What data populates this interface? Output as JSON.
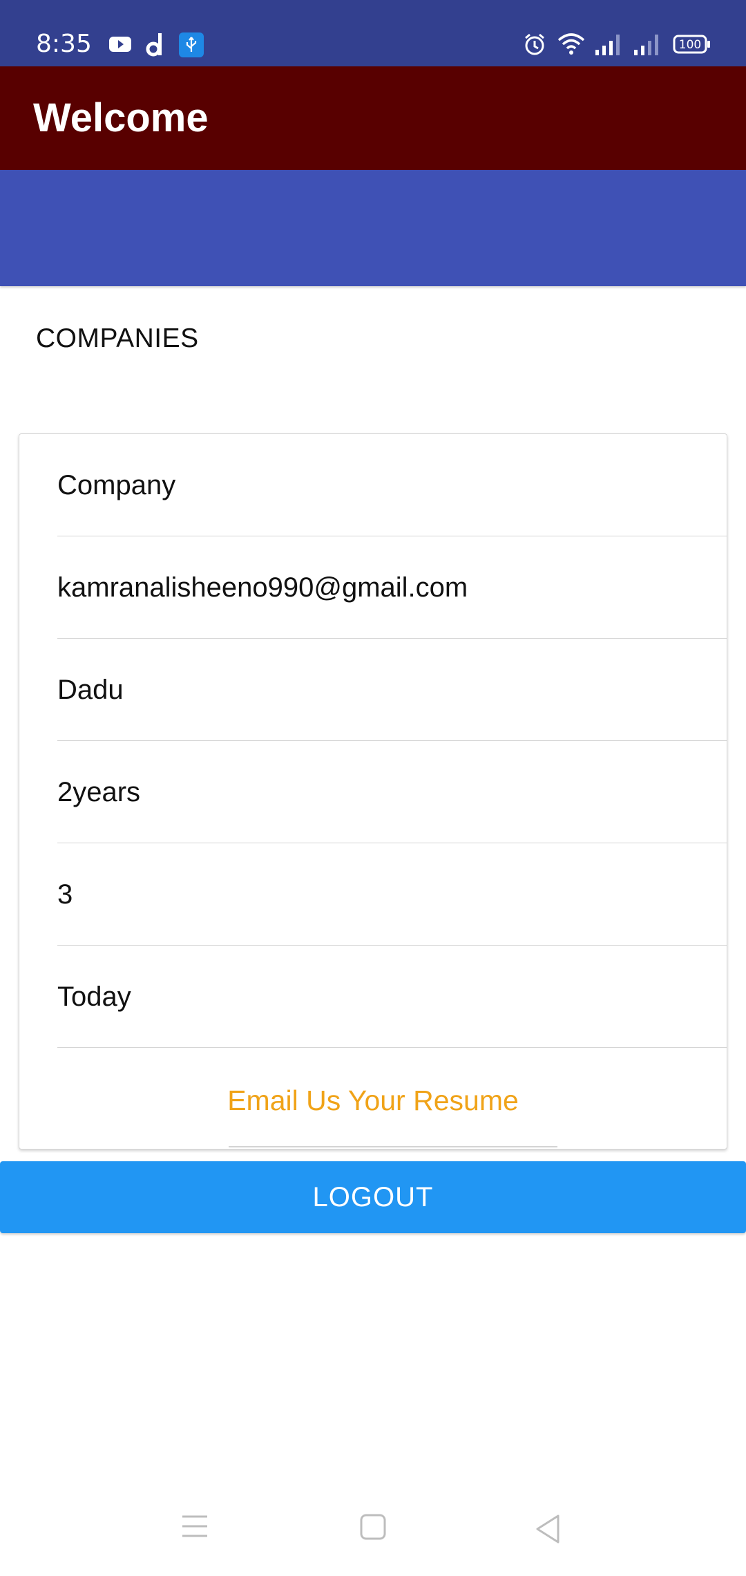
{
  "status_bar": {
    "time": "8:35",
    "battery": "100",
    "icons": [
      "youtube-icon",
      "d-app-icon",
      "usb-icon",
      "alarm-icon",
      "wifi-icon",
      "signal-icon",
      "signal-icon",
      "battery-icon"
    ]
  },
  "app_bar": {
    "title": "Welcome"
  },
  "section": {
    "label": "COMPANIES"
  },
  "card": {
    "rows": [
      "Company",
      "kamranalisheeno990@gmail.com",
      "Dadu",
      "2years",
      "3",
      "Today"
    ],
    "email_link": "Email Us Your Resume"
  },
  "logout": {
    "label": "LOGOUT"
  },
  "nav": {
    "buttons": [
      "menu-icon",
      "home-icon",
      "back-icon"
    ]
  },
  "colors": {
    "status_bar": "#33408f",
    "app_bar": "#580000",
    "header_band": "#3f51b5",
    "accent_link": "#f0a318",
    "logout_button": "#2196f3"
  }
}
